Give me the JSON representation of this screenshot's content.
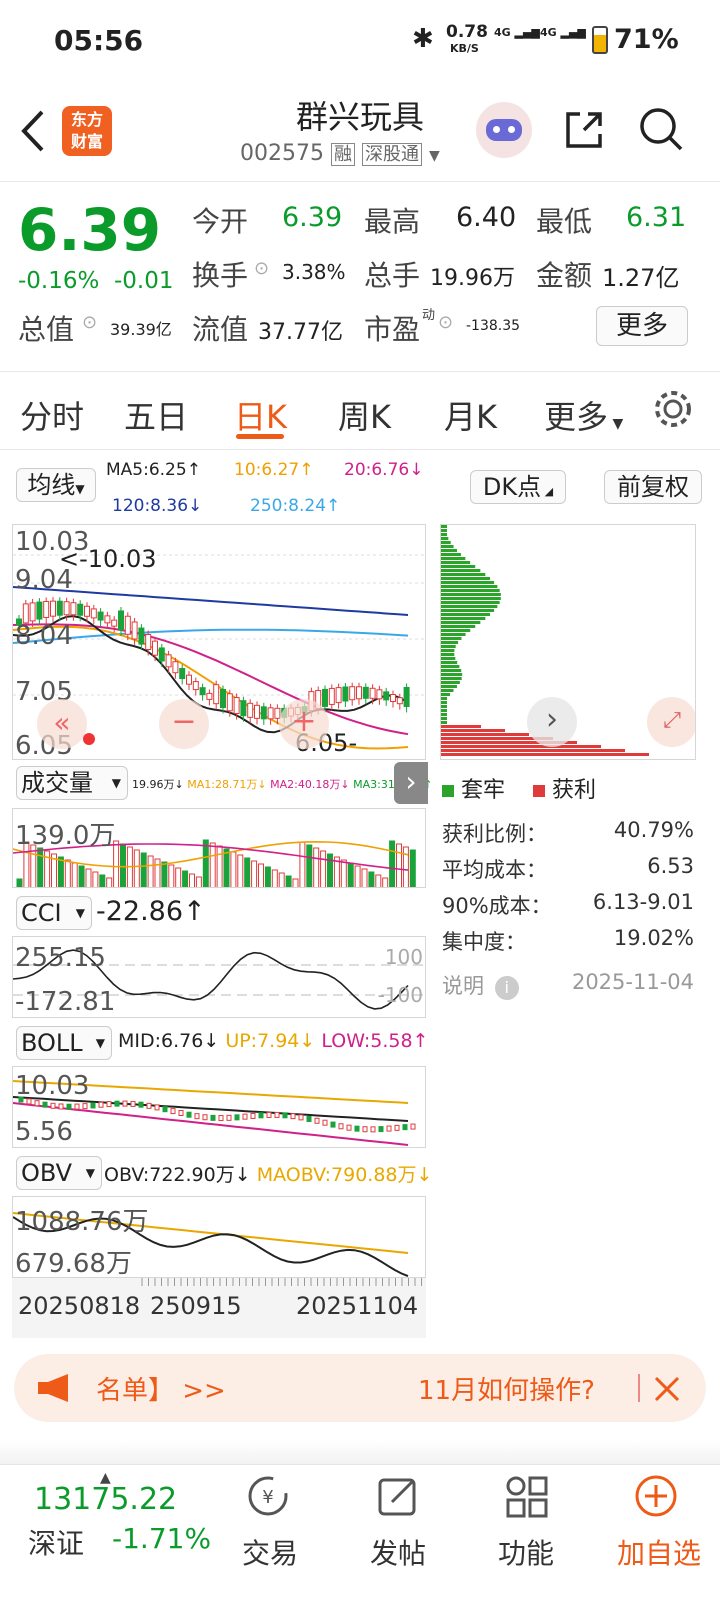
{
  "status": {
    "time": "05:56",
    "net_speed": "0.78",
    "net_unit": "KB/S",
    "sig1": "4G",
    "sig2": "4G",
    "battery": "71%"
  },
  "header": {
    "logo_line1": "东方",
    "logo_line2": "财富",
    "title": "群兴玩具",
    "code": "002575",
    "tag1": "融",
    "tag2": "深股通"
  },
  "quote": {
    "price": "6.39",
    "change_pct": "-0.16%",
    "change": "-0.01",
    "open_label": "今开",
    "open": "6.39",
    "high_label": "最高",
    "high": "6.40",
    "low_label": "最低",
    "low": "6.31",
    "turnover_label": "换手",
    "turnover": "3.38%",
    "volume_label": "总手",
    "volume": "19.96万",
    "amount_label": "金额",
    "amount": "1.27亿",
    "mcap_label": "总值",
    "mcap": "39.39亿",
    "float_label": "流值",
    "float": "37.77亿",
    "pe_label": "市盈",
    "pe_sup": "动",
    "pe": "-138.35",
    "more": "更多"
  },
  "tabs": [
    "分时",
    "五日",
    "日K",
    "周K",
    "月K",
    "更多"
  ],
  "active_tab": "日K",
  "kline": {
    "ma_select": "均线",
    "ma5": "MA5:6.25↑",
    "ma10": "10:6.27↑",
    "ma20": "20:6.76↓",
    "ma120": "120:8.36↓",
    "ma250": "250:8.24↑",
    "dk_button": "DK点",
    "fq_button": "前复权",
    "price_high": "10.03",
    "price_high_note": "<-10.03",
    "price_mid1": "9.04",
    "price_mid2": "8.04",
    "price_mid3": "7.05",
    "price_low": "6.05",
    "price_low_note": "6.05-",
    "colors": {
      "ma5": "#222222",
      "ma10": "#f0a000",
      "ma20": "#d0208a",
      "ma120": "#1f3aa0",
      "ma250": "#3aa8e8"
    }
  },
  "volume": {
    "select": "成交量",
    "vals": "19.96万↓",
    "ma1": "MA1:28.71万↓",
    "ma2": "MA2:40.18万↓",
    "ma3": "MA3:31.28万↑",
    "top": "139.0万"
  },
  "cci": {
    "select": "CCI",
    "value": "-22.86↑",
    "top": "255.15",
    "bottom": "-172.81",
    "line_hi": "100",
    "line_lo": "-100"
  },
  "boll": {
    "select": "BOLL",
    "mid": "MID:6.76↓",
    "up": "UP:7.94↓",
    "low": "LOW:5.58↑",
    "top": "10.03",
    "bottom": "5.56"
  },
  "obv": {
    "select": "OBV",
    "obv": "OBV:722.90万↓",
    "maobv": "MAOBV:790.88万↓",
    "top": "1088.76万",
    "bottom": "679.68万"
  },
  "dates": {
    "d1": "20250818",
    "d2": "250915",
    "d3": "20251104"
  },
  "chips": {
    "legend_trapped": "套牢",
    "legend_profit": "获利",
    "rows": [
      {
        "label": "获利比例：",
        "value": "40.79%"
      },
      {
        "label": "平均成本：",
        "value": "6.53"
      },
      {
        "label": "90%成本：",
        "value": "6.13-9.01"
      },
      {
        "label": "集中度：",
        "value": "19.02%"
      }
    ],
    "note_label": "说明",
    "date": "2025-11-04"
  },
  "banner": {
    "left_text": "名单】 >>",
    "right_text": "11月如何操作?"
  },
  "bottom": {
    "index_value": "13175.22",
    "index_name": "深证",
    "index_change": "-1.71%",
    "nav": [
      "交易",
      "发帖",
      "功能",
      "加自选"
    ]
  }
}
